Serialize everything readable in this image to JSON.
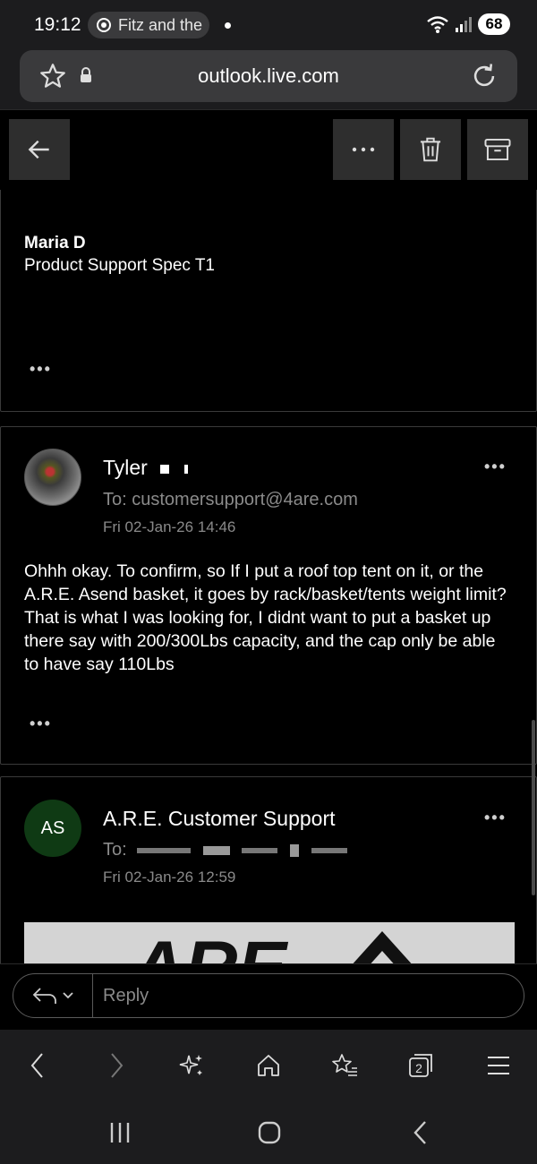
{
  "status_bar": {
    "time": "19:12",
    "media_chip": "Fitz and the",
    "battery": "68"
  },
  "url_bar": {
    "url": "outlook.live.com"
  },
  "toolbar": {
    "back": "back-arrow-icon",
    "more": "more-icon",
    "delete": "trash-icon",
    "archive": "archive-icon"
  },
  "messages": [
    {
      "signature_name": "Maria D",
      "signature_title": "Product Support Spec T1",
      "more_label": "•••"
    },
    {
      "sender": "Tyler",
      "to": "To: customersupport@4are.com",
      "date": "Fri 02-Jan-26 14:46",
      "body": "Ohhh okay. To confirm, so If I put a roof top tent on it, or the A.R.E. Asend basket, it goes by rack/basket/tents weight limit? That is what I was looking for, I didnt want to put a basket up there say with 200/300Lbs capacity, and the cap only be able to have say 110Lbs",
      "more_label": "•••",
      "menu_label": "•••"
    },
    {
      "initials": "AS",
      "sender": "A.R.E. Customer Support",
      "to": "To:",
      "date": "Fri 02-Jan-26 12:59",
      "menu_label": "•••",
      "banner_text": "ARE"
    }
  ],
  "reply": {
    "placeholder": "Reply"
  },
  "browser_nav": {
    "tabs_count": "2"
  },
  "colors": {
    "background": "#000000",
    "chrome": "#1c1c1e",
    "muted_text": "#8a8a8a",
    "avatar_green": "#0f3a14"
  }
}
